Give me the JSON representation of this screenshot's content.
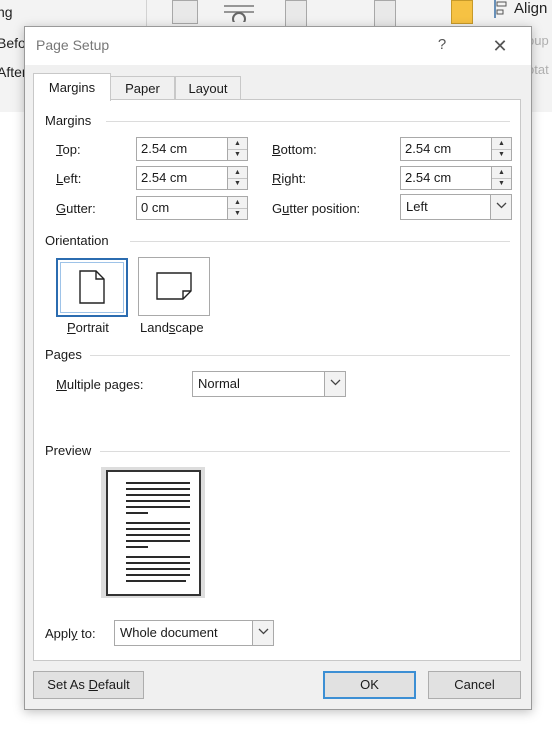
{
  "background": {
    "ribbon_left_items": [
      "ng",
      "Befo",
      "After"
    ],
    "ribbon_right_item": "Align",
    "ribbon_right_faded": [
      "oup",
      "otat"
    ]
  },
  "dialog": {
    "title": "Page Setup",
    "help_symbol": "?",
    "close_symbol": "✕",
    "tabs": [
      {
        "label": "Margins",
        "active": true
      },
      {
        "label": "Paper",
        "active": false
      },
      {
        "label": "Layout",
        "active": false
      }
    ],
    "margins": {
      "group_label": "Margins",
      "top": {
        "label": "Top:",
        "hotkey": "T",
        "rest": "op:",
        "value": "2.54 cm"
      },
      "bottom": {
        "label": "Bottom:",
        "hotkey": "B",
        "rest": "ottom:",
        "value": "2.54 cm"
      },
      "left": {
        "label": "Left:",
        "hotkey": "L",
        "rest": "eft:",
        "value": "2.54 cm"
      },
      "right": {
        "label": "Right:",
        "hotkey": "R",
        "rest": "ight:",
        "value": "2.54 cm"
      },
      "gutter": {
        "label": "Gutter:",
        "hotkey": "G",
        "rest": "utter:",
        "value": "0 cm"
      },
      "gutter_position": {
        "label_pre": "G",
        "hotkey": "u",
        "label_post": "tter position:",
        "value": "Left"
      }
    },
    "orientation": {
      "group_label": "Orientation",
      "portrait": {
        "label": "Portrait",
        "hotkey": "P",
        "rest": "ortrait",
        "selected": true
      },
      "landscape": {
        "label_pre": "Land",
        "hotkey": "s",
        "label_post": "cape",
        "selected": false
      }
    },
    "pages": {
      "group_label": "Pages",
      "multiple_label_pre": "",
      "multiple_hotkey": "M",
      "multiple_label_post": "ultiple pages:",
      "multiple_value": "Normal"
    },
    "preview": {
      "group_label": "Preview"
    },
    "apply_to": {
      "label_pre": "Appl",
      "hotkey": "y",
      "label_post": " to:",
      "value": "Whole document"
    },
    "buttons": {
      "set_default_pre": "Set As ",
      "set_default_hotkey": "D",
      "set_default_post": "efault",
      "ok": "OK",
      "cancel": "Cancel"
    },
    "accent_color": "#3c8fd4"
  }
}
